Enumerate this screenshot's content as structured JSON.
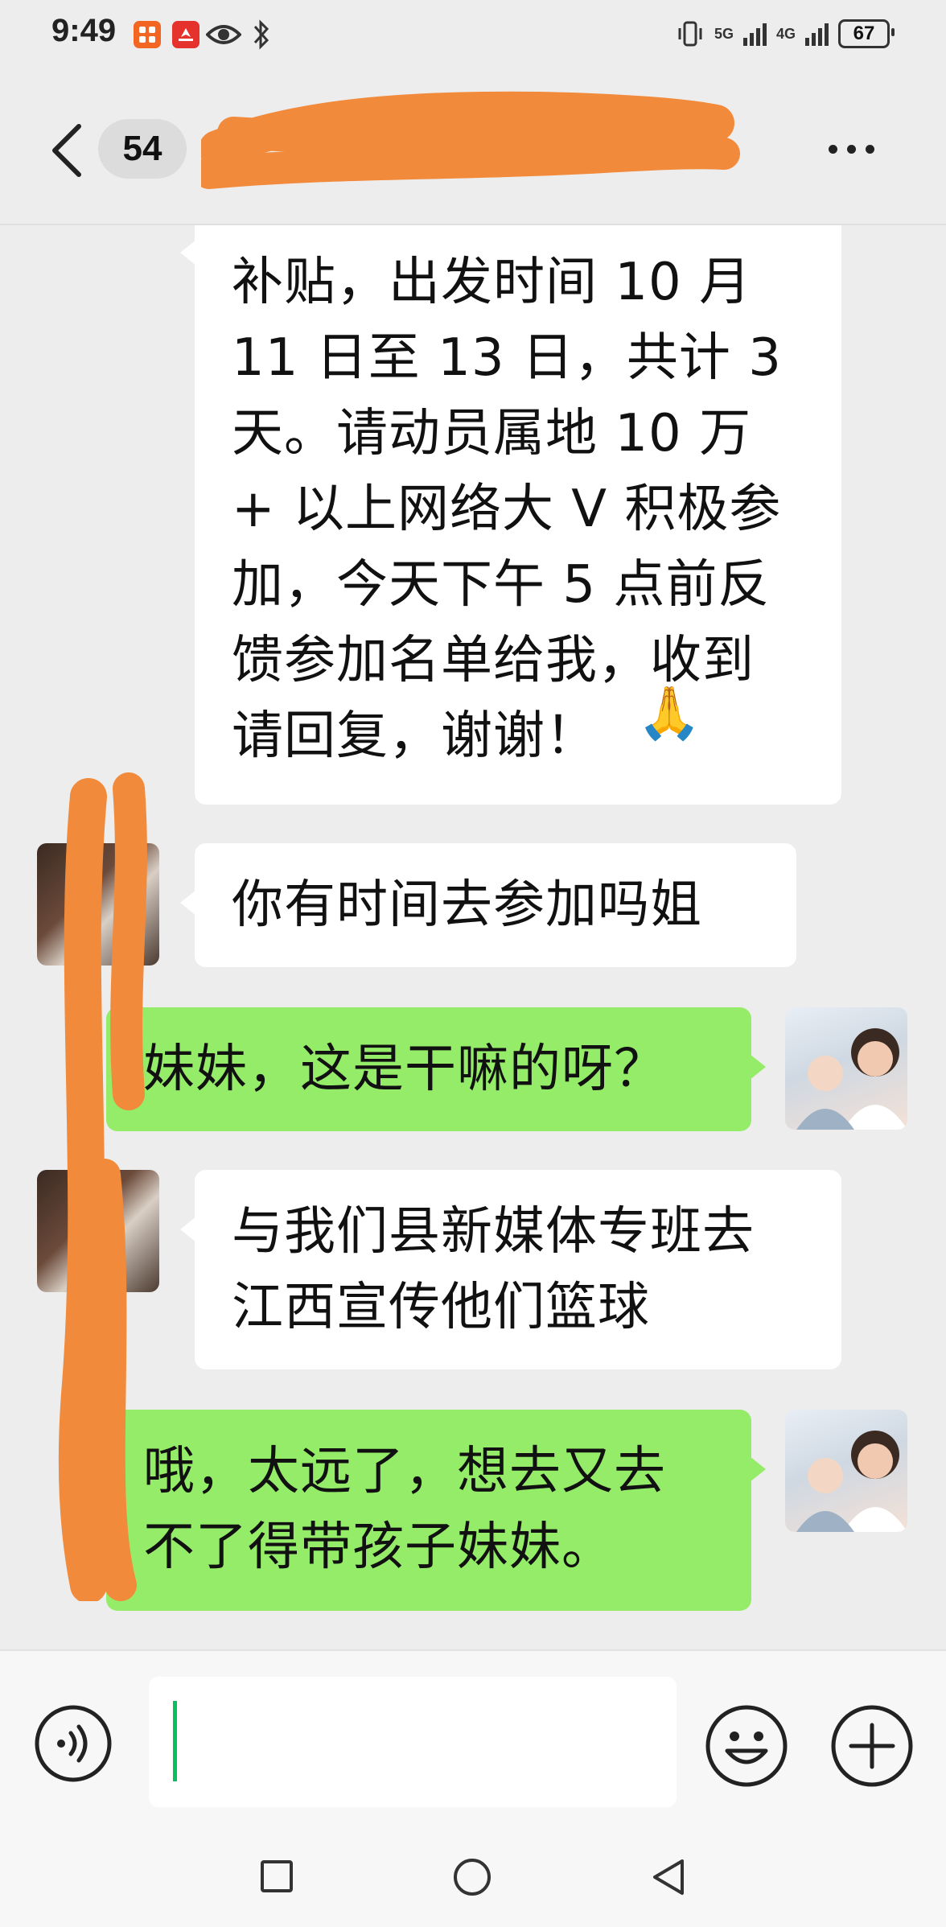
{
  "status_bar": {
    "time": "9:49",
    "network_1": "5G",
    "network_2": "4G",
    "battery": "67",
    "icons": [
      "app-icon-orange",
      "huawei-app-icon",
      "eye-icon",
      "bluetooth-icon",
      "vibrate-icon",
      "signal-icon",
      "battery-icon"
    ]
  },
  "header": {
    "unread_count": "54",
    "title_redacted": true,
    "back_icon": "chevron-left-icon",
    "more_icon": "more-dots-icon"
  },
  "messages": [
    {
      "side": "in",
      "text": "补贴，出发时间 10 月\n11 日至 13 日，共计 3\n天。请动员属地 10 万\n+ 以上网络大 V 积极参\n加，今天下午 5 点前反\n馈参加名单给我，收到\n请回复，谢谢！",
      "emoji": "🙏"
    },
    {
      "side": "in",
      "text": "你有时间去参加吗姐"
    },
    {
      "side": "out",
      "text": "妹妹，这是干嘛的呀？"
    },
    {
      "side": "in",
      "text": "与我们县新媒体专班去\n江西宣传他们篮球"
    },
    {
      "side": "out",
      "text": "哦，太远了，想去又去\n不了得带孩子妹妹。"
    }
  ],
  "input_bar": {
    "value": "",
    "voice_icon": "voice-icon",
    "emoji_icon": "emoji-icon",
    "plus_icon": "plus-icon"
  },
  "nav_bar": {
    "icons": [
      "recent-apps-icon",
      "home-icon",
      "back-triangle-icon"
    ]
  },
  "colors": {
    "background": "#EDEDED",
    "bubble_out": "#95EC69",
    "bubble_in": "#FFFFFF",
    "caret": "#07C160",
    "redaction": "#F28A3B"
  }
}
